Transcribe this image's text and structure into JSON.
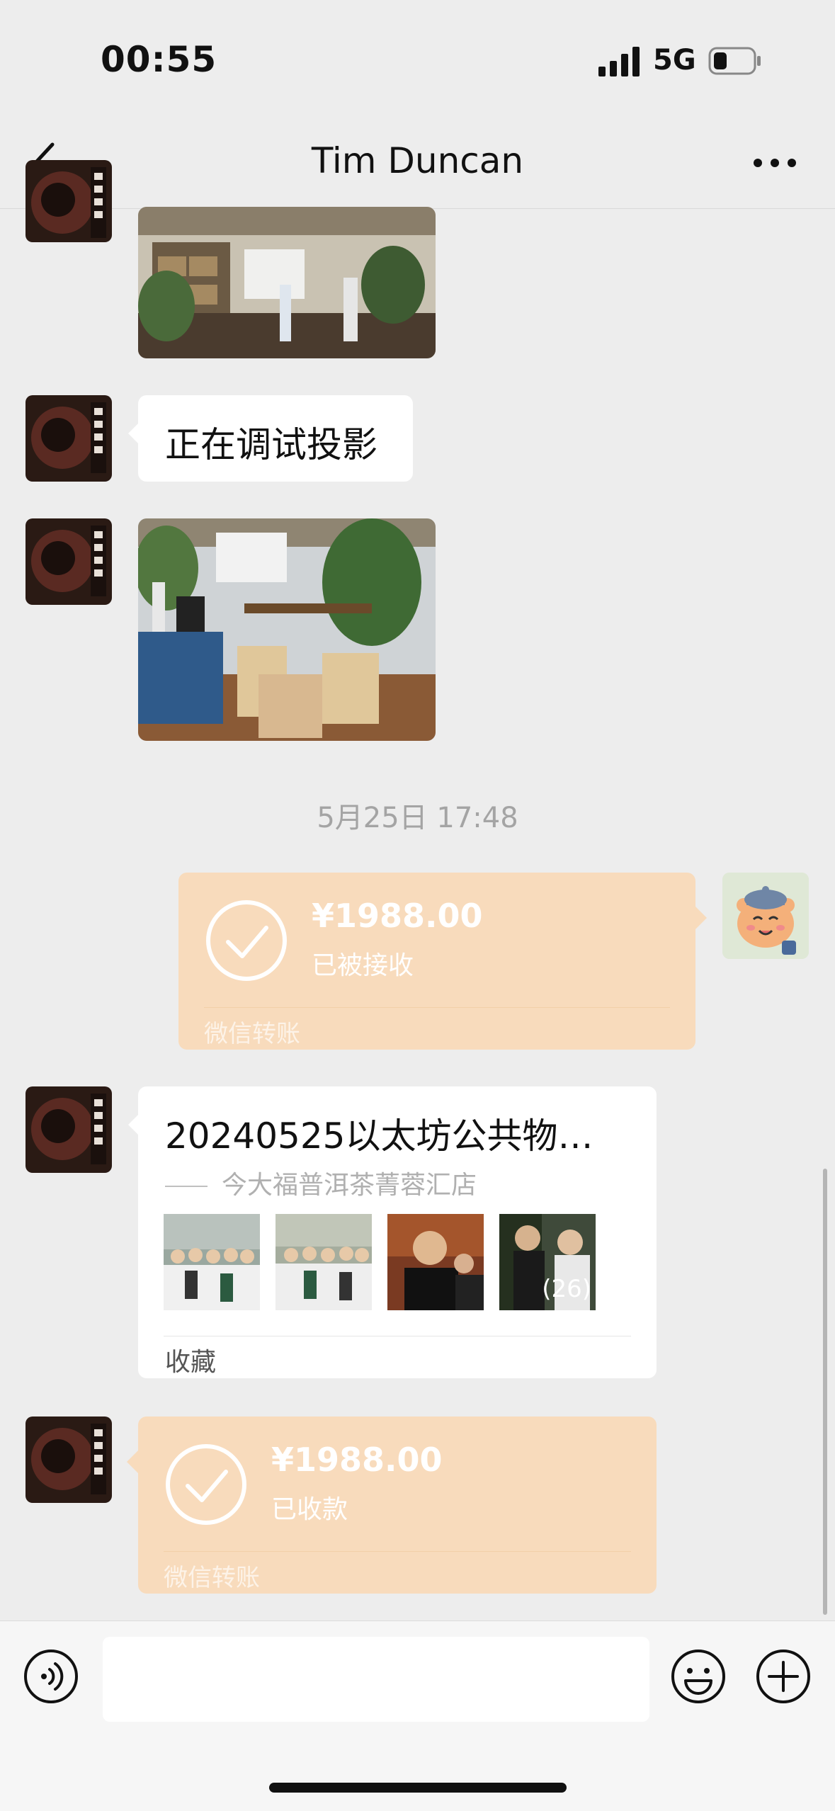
{
  "status_bar": {
    "time": "00:55",
    "network": "5G",
    "icons": [
      "signal-icon",
      "battery-icon"
    ]
  },
  "nav": {
    "title": "Tim Duncan",
    "back_icon": "chevron-left-icon",
    "more_icon": "more-dots-icon"
  },
  "messages": {
    "text_1": "正在调试投影",
    "timestamp": "5月25日 17:48",
    "transfer_sent": {
      "amount": "¥1988.00",
      "status": "已被接收",
      "footer": "微信转账"
    },
    "card": {
      "title": "20240525以太坊公共物…",
      "source": "今大福普洱茶菁蓉汇店",
      "photo_count": "(26)",
      "footer": "收藏"
    },
    "transfer_received": {
      "amount": "¥1988.00",
      "status": "已收款",
      "footer": "微信转账"
    }
  },
  "input_bar": {
    "icons": [
      "voice-icon",
      "emoji-icon",
      "plus-icon"
    ],
    "placeholder": ""
  },
  "colors": {
    "background": "#ededed",
    "transfer_bubble": "#f8dbbc",
    "bubble_white": "#ffffff"
  }
}
